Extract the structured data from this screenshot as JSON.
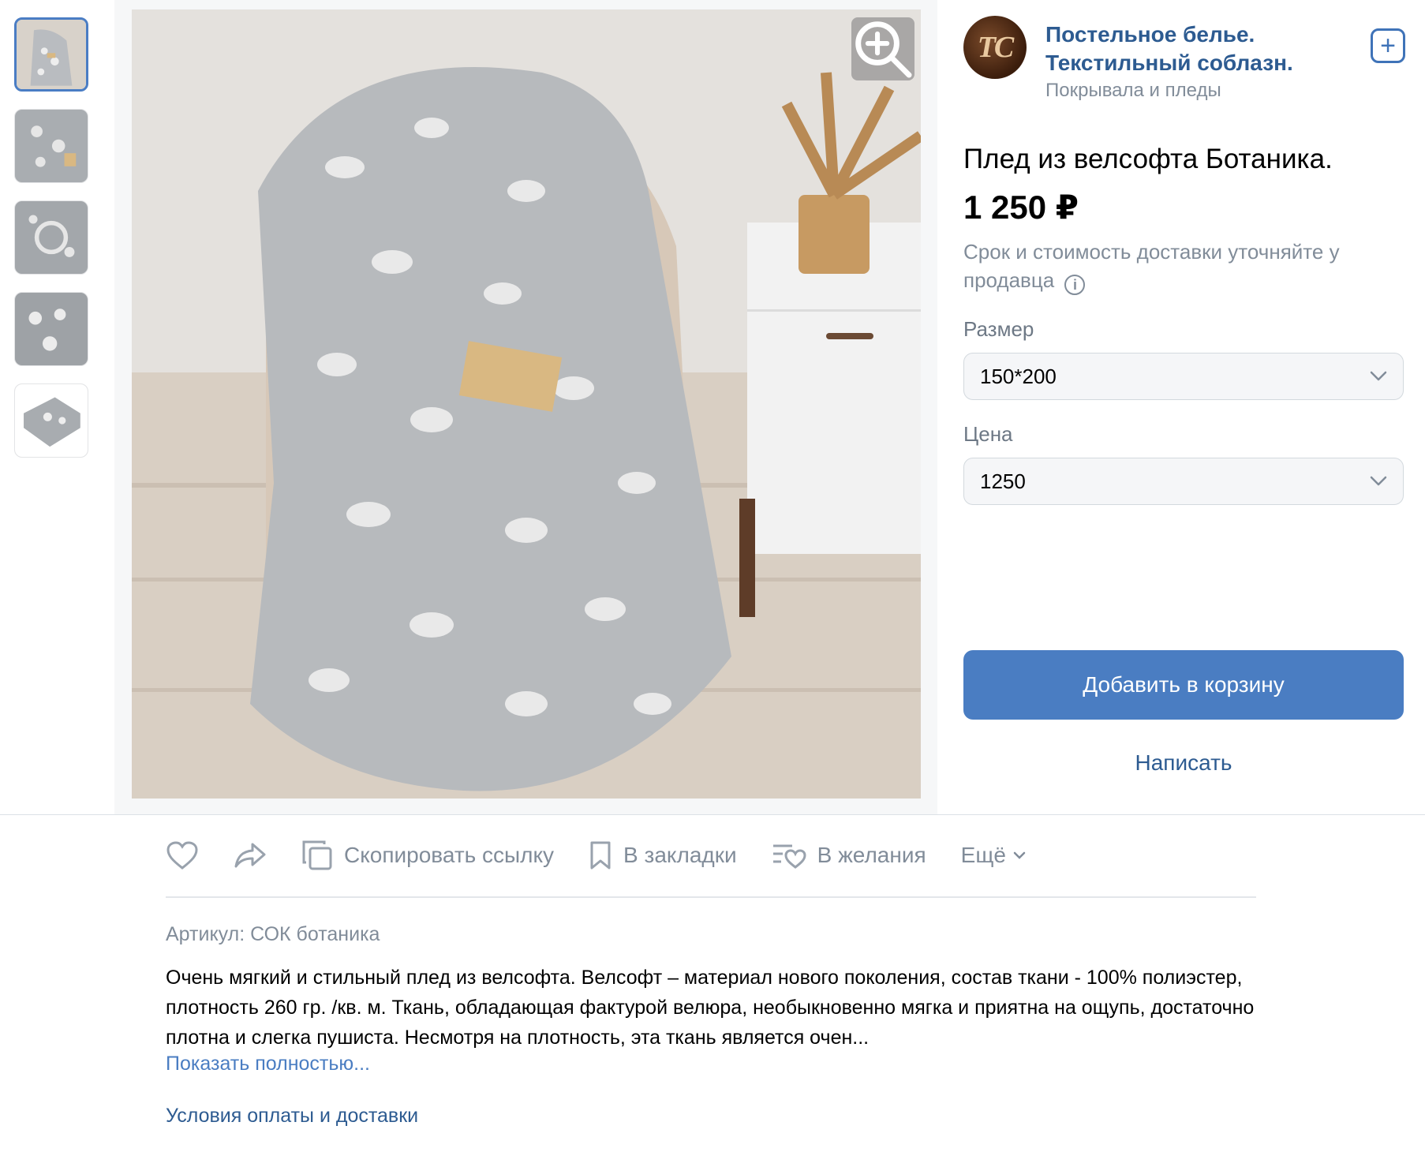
{
  "gallery": {
    "thumbnails": [
      {
        "alt": "thumb-1"
      },
      {
        "alt": "thumb-2"
      },
      {
        "alt": "thumb-3"
      },
      {
        "alt": "thumb-4"
      },
      {
        "alt": "thumb-5"
      }
    ],
    "active_index": 0
  },
  "shop": {
    "logo_text": "TC",
    "name": "Постельное белье. Текстильный соблазн.",
    "category": "Покрывала и пледы"
  },
  "product": {
    "title": "Плед из велсофта Ботаника.",
    "price": "1 250 ₽",
    "delivery_note": "Срок и стоимость доставки уточняйте у продавца"
  },
  "options": {
    "size_label": "Размер",
    "size_value": "150*200",
    "price_label": "Цена",
    "price_value": "1250"
  },
  "buttons": {
    "add_to_cart": "Добавить в корзину",
    "write": "Написать"
  },
  "actions": {
    "copy_link": "Скопировать ссылку",
    "bookmarks": "В закладки",
    "wishlist": "В желания",
    "more": "Ещё"
  },
  "details": {
    "sku": "Артикул: СОК ботаника",
    "description": "Очень мягкий и стильный плед из велсофта. Велсофт – материал нового поколения, состав ткани - 100% полиэстер, плотность 260 гр. /кв. м. Ткань, обладающая фактурой велюра, необыкновенно мягка и приятна на ощупь, достаточно плотна и слегка пушиста. Несмотря на плотность, эта ткань является очен...",
    "show_more": "Показать полностью...",
    "payment_terms": "Условия оплаты и доставки"
  },
  "colors": {
    "accent": "#4a7dc2",
    "link": "#2d5b91",
    "muted": "#818c99"
  }
}
